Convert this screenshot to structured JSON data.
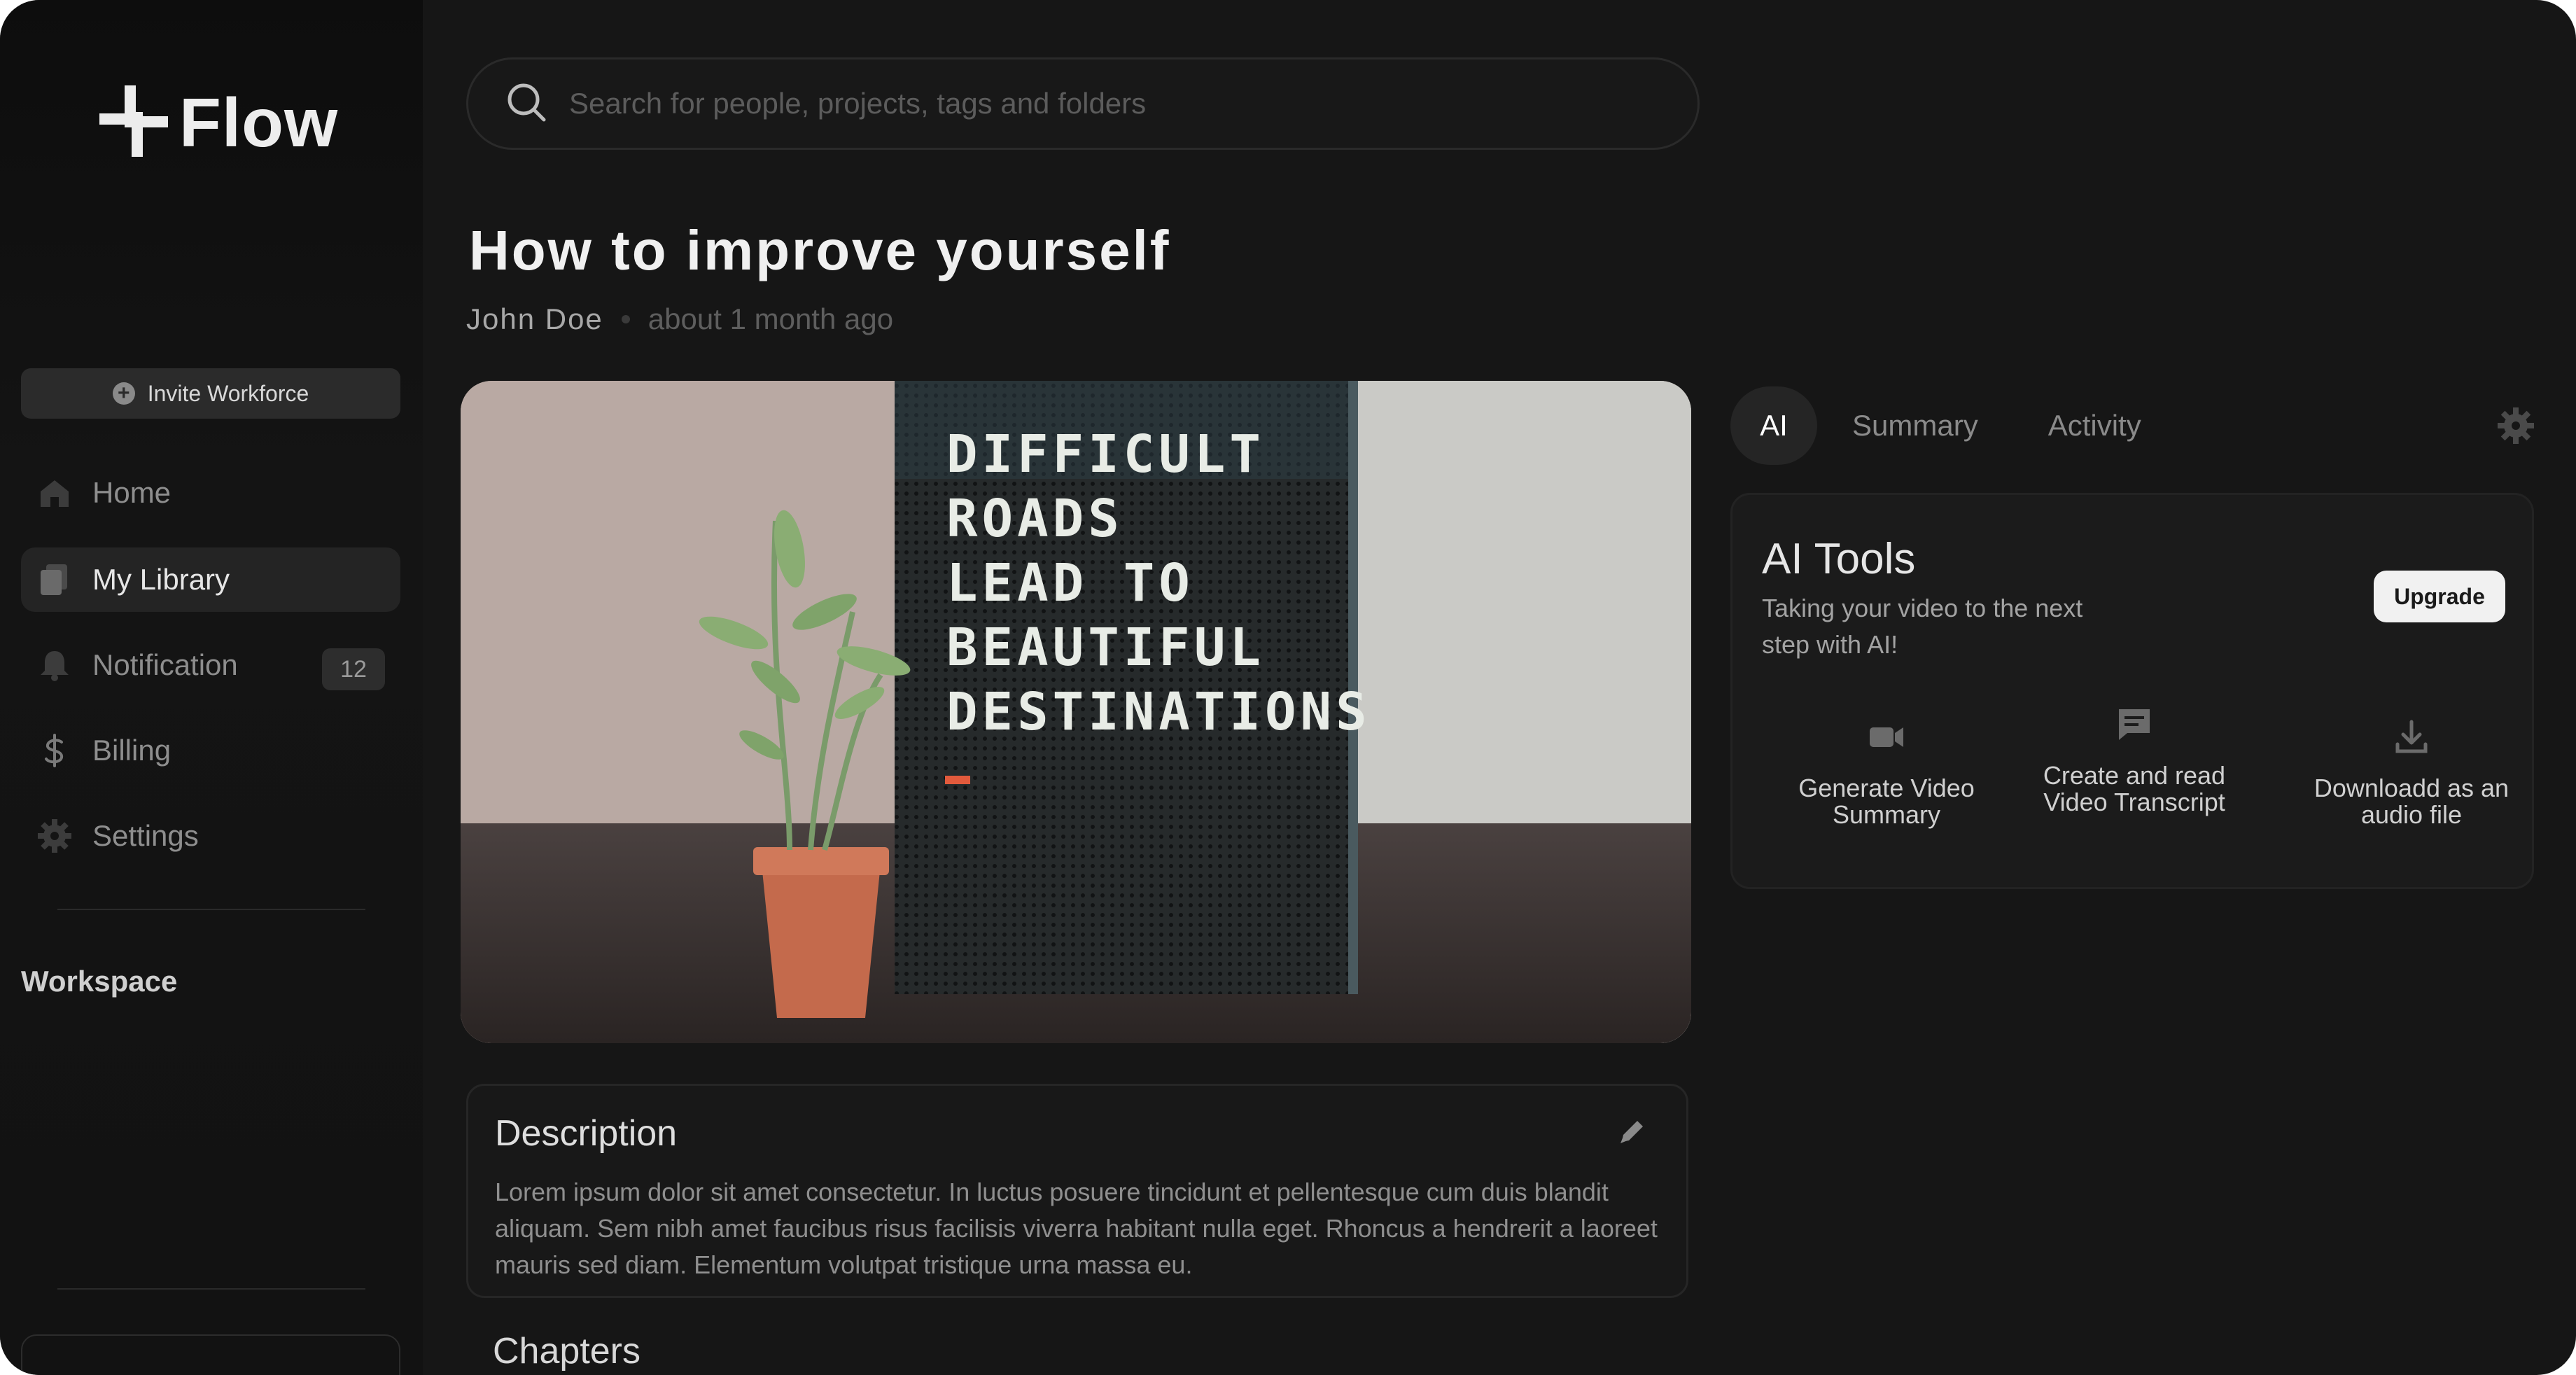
{
  "app": {
    "name": "Flow"
  },
  "sidebar": {
    "invite_label": "Invite Workforce",
    "items": [
      {
        "label": "Home",
        "icon": "home-icon"
      },
      {
        "label": "My Library",
        "icon": "library-icon",
        "active": true
      },
      {
        "label": "Notification",
        "icon": "bell-icon",
        "badge": "12"
      },
      {
        "label": "Billing",
        "icon": "dollar-icon"
      },
      {
        "label": "Settings",
        "icon": "gear-icon"
      }
    ],
    "workspace_label": "Workspace"
  },
  "search": {
    "placeholder": "Search for people, projects, tags and folders"
  },
  "video": {
    "title": "How to improve yourself",
    "author": "John Doe",
    "time": "about 1 month ago",
    "board_text": [
      "DIFFICULT",
      "ROADS",
      "LEAD TO",
      "BEAUTIFUL",
      "DESTINATIONS"
    ]
  },
  "description": {
    "title": "Description",
    "text": "Lorem ipsum dolor sit amet consectetur. In luctus posuere tincidunt et pellentesque cum duis blandit aliquam. Sem nibh amet faucibus risus facilisis viverra habitant nulla eget. Rhoncus a hendrerit a laoreet mauris sed diam. Elementum volutpat tristique urna massa eu."
  },
  "chapters": {
    "title": "Chapters"
  },
  "panel": {
    "tabs": [
      "AI",
      "Summary",
      "Activity"
    ],
    "active_tab": "AI",
    "tools": {
      "title": "AI Tools",
      "subtitle": "Taking your video to the next step with AI!",
      "upgrade_label": "Upgrade",
      "items": [
        {
          "label": "Generate Video Summary",
          "icon": "video-camera-icon"
        },
        {
          "label": "Create and read Video Transcript",
          "icon": "chat-icon"
        },
        {
          "label": "Downloadd as an audio file",
          "icon": "download-icon"
        }
      ]
    }
  },
  "colors": {
    "background": "#161616",
    "sidebar": "#0f0f0f",
    "accent_light": "#f1f1f1"
  }
}
